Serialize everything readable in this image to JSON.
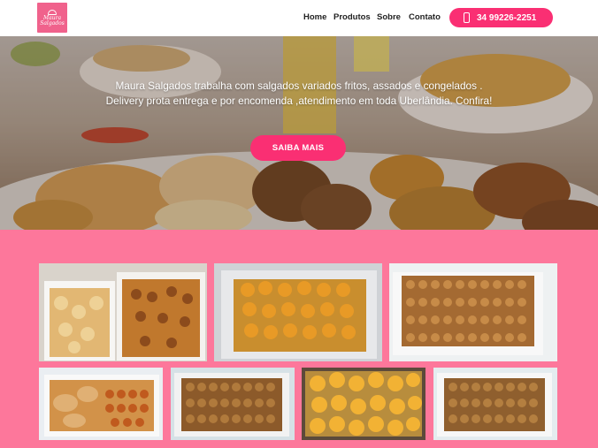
{
  "header": {
    "logo_alt_lines": [
      "Maura",
      "Salgados"
    ],
    "nav": [
      "Home",
      "Produtos",
      "Sobre",
      "Contato"
    ],
    "phone": "34 99226-2251",
    "accent": "#fa2f73"
  },
  "hero": {
    "line1": "Maura Salgados trabalha com salgados variados fritos, assados e congelados .",
    "line2": "Delivery prota entrega e por encomenda ,atendimento em toda Uberlândia. Confira!",
    "cta": "SAIBA MAIS"
  },
  "gallery": {
    "background": "#fd779b",
    "photos": [
      "assorted-salgados-trays",
      "coxinha-tray-foil",
      "bolinha-tray",
      "mixed-salgados-box",
      "kibe-tray",
      "pastel-tray",
      "bolinha-tray-2"
    ]
  }
}
